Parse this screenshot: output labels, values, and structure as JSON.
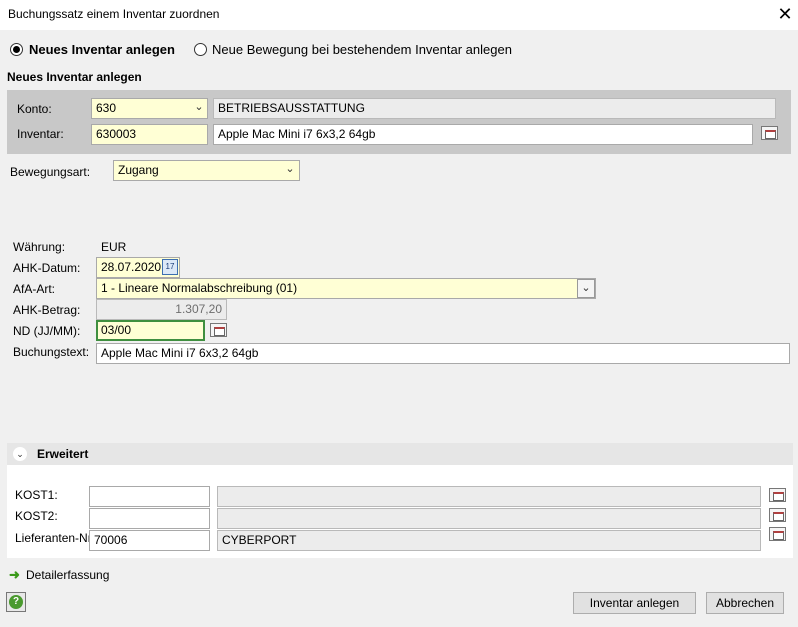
{
  "window": {
    "title": "Buchungssatz einem Inventar zuordnen",
    "close_glyph": "✕"
  },
  "mode": {
    "new_label": "Neues Inventar anlegen",
    "existing_label": "Neue Bewegung bei bestehendem Inventar anlegen",
    "selected": "new"
  },
  "section_title": "Neues Inventar anlegen",
  "konto": {
    "label": "Konto:",
    "value": "630",
    "description": "BETRIEBSAUSSTATTUNG"
  },
  "inventar": {
    "label": "Inventar:",
    "value": "630003",
    "description": "Apple Mac Mini i7 6x3,2 64gb"
  },
  "bewegungsart": {
    "label": "Bewegungsart:",
    "value": "Zugang"
  },
  "waehrung": {
    "label": "Währung:",
    "value": "EUR"
  },
  "ahk_datum": {
    "label": "AHK-Datum:",
    "value": "28.07.2020",
    "calendar_text": "17"
  },
  "afa_art": {
    "label": "AfA-Art:",
    "value": "1 - Lineare Normalabschreibung (01)"
  },
  "ahk_betrag": {
    "label": "AHK-Betrag:",
    "value": "1.307,20"
  },
  "nd": {
    "label": "ND (JJ/MM):",
    "value": "03/00"
  },
  "buchungstext": {
    "label": "Buchungstext:",
    "value": "Apple Mac Mini i7 6x3,2 64gb"
  },
  "erweitert": {
    "label": "Erweitert",
    "kost1": {
      "label": "KOST1:",
      "value": "",
      "description": ""
    },
    "kost2": {
      "label": "KOST2:",
      "value": "",
      "description": ""
    },
    "lieferant": {
      "label": "Lieferanten-Nr.:",
      "value": "70006",
      "description": "CYBERPORT"
    }
  },
  "detail_link": "Detailerfassung",
  "buttons": {
    "create": "Inventar anlegen",
    "cancel": "Abbrechen"
  },
  "colors": {
    "required_field": "#ffffd5",
    "focus_border": "#3f8f3f",
    "link_arrow": "#3a9a1a"
  },
  "icons": {
    "picker": "list-picker-icon",
    "calendar": "calendar-icon",
    "help": "help-icon",
    "expand": "chevron-down-icon",
    "detail": "arrow-right-icon"
  }
}
